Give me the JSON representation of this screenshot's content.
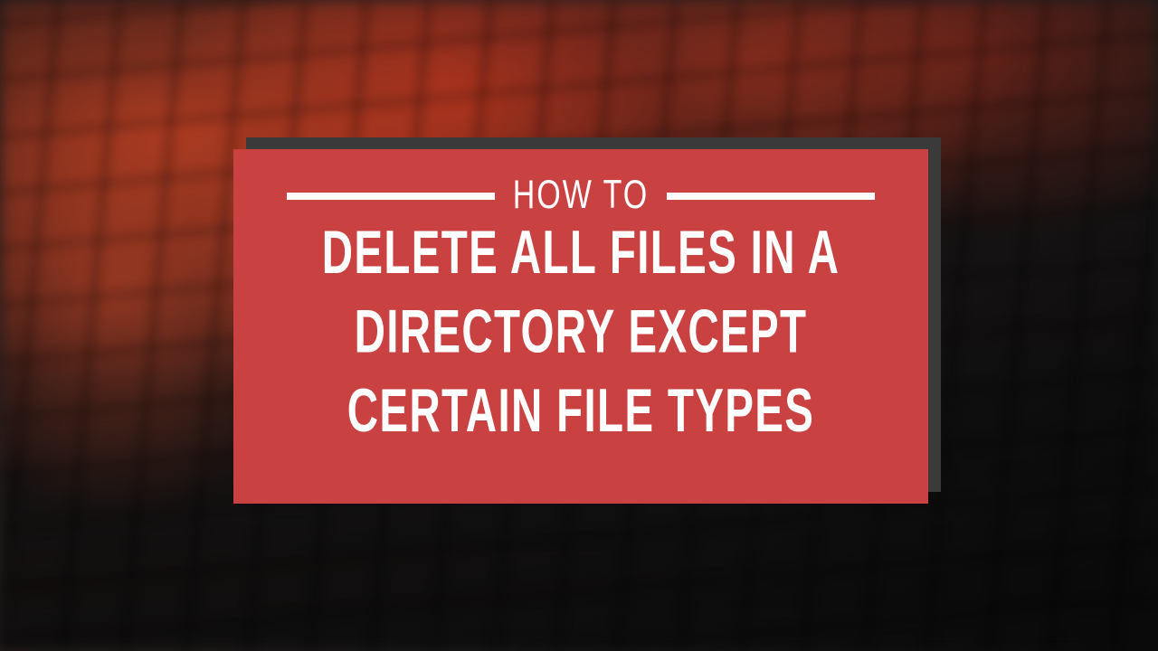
{
  "card": {
    "eyebrow": "HOW TO",
    "title": "DELETE ALL FILES IN A DIRECTORY EXCEPT CERTAIN FILE TYPES"
  },
  "colors": {
    "card_bg": "#c94141",
    "shadow": "#3a3a3a",
    "text": "#ffffff"
  }
}
